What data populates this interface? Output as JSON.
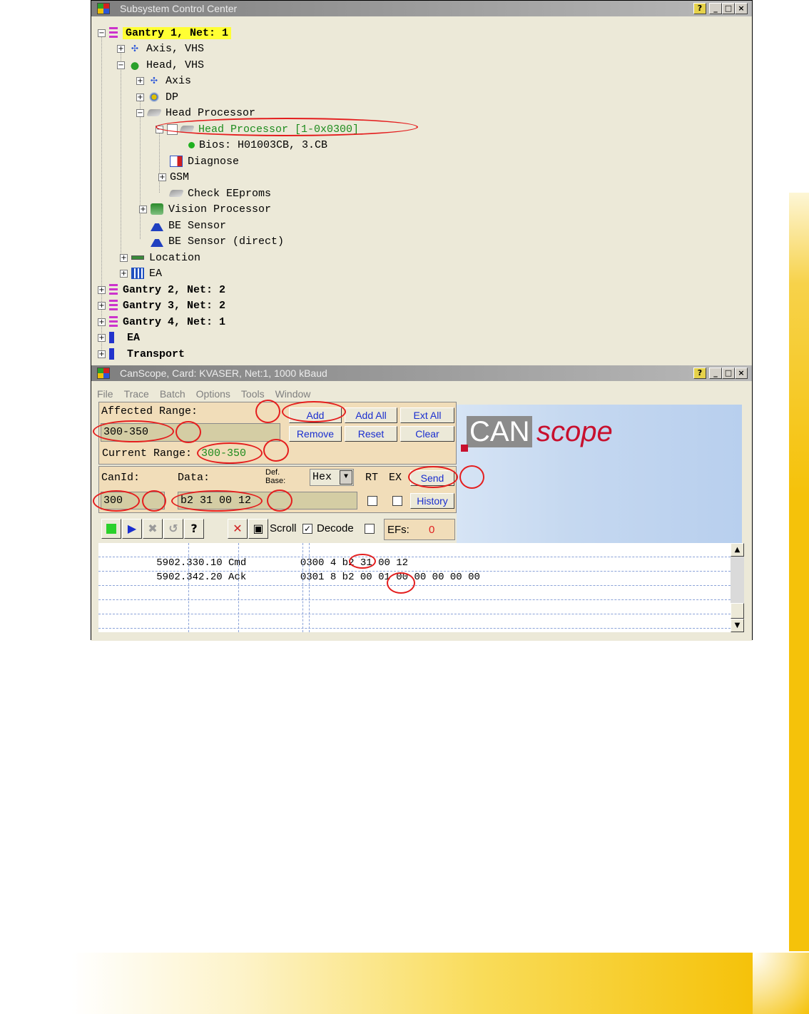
{
  "subsystem_window": {
    "title": "Subsystem Control Center",
    "tree": [
      {
        "label": "Gantry 1, Net: 1"
      },
      {
        "label": "Axis, VHS"
      },
      {
        "label": "Head, VHS"
      },
      {
        "label": "Axis"
      },
      {
        "label": "DP"
      },
      {
        "label": "Head Processor"
      },
      {
        "label": "Head Processor [1-0x0300]"
      },
      {
        "label": "Bios: H01003CB, 3.CB"
      },
      {
        "label": "Diagnose"
      },
      {
        "label": "GSM"
      },
      {
        "label": "Check EEproms"
      },
      {
        "label": "Vision Processor"
      },
      {
        "label": "BE Sensor"
      },
      {
        "label": "BE Sensor (direct)"
      },
      {
        "label": "Location"
      },
      {
        "label": "EA"
      },
      {
        "label": "Gantry 2, Net: 2"
      },
      {
        "label": "Gantry 3, Net: 2"
      },
      {
        "label": "Gantry 4, Net: 1"
      },
      {
        "label": "EA"
      },
      {
        "label": "Transport"
      }
    ]
  },
  "canscope_window": {
    "title": "CanScope, Card: KVASER, Net:1, 1000 kBaud",
    "menu": [
      "File",
      "Trace",
      "Batch",
      "Options",
      "Tools",
      "Window"
    ],
    "affected_range_label": "Affected Range:",
    "affected_range_value": "300-350",
    "buttons": {
      "add": "Add",
      "add_all": "Add All",
      "ext_all": "Ext All",
      "remove": "Remove",
      "reset": "Reset",
      "clear": "Clear",
      "send": "Send",
      "history": "History"
    },
    "current_range_label": "Current Range:",
    "current_range_value": "300-350",
    "canid_label": "CanId:",
    "data_label": "Data:",
    "def_base_label": "Def. Base:",
    "base_value": "Hex",
    "rt_label": "RT",
    "ex_label": "EX",
    "canid_value": "300",
    "data_value": "b2 31 00 12",
    "scroll_label": "Scroll",
    "decode_label": "Decode",
    "efs_label": "EFs:",
    "efs_value": "0",
    "logo_can": "CAN",
    "logo_scope": "scope",
    "trace_rows": [
      "5902.330.10 Cmd         0300 4 b2 31 00 12",
      "5902.342.20 Ack         0301 8 b2 00 01 00 00 00 00 00"
    ]
  },
  "colors": {
    "accent_ring": "#e41e1e",
    "highlight": "#ffff33",
    "panel": "#f1ddb9",
    "button_text": "#1a2ecf",
    "band": "#f5c20a"
  }
}
